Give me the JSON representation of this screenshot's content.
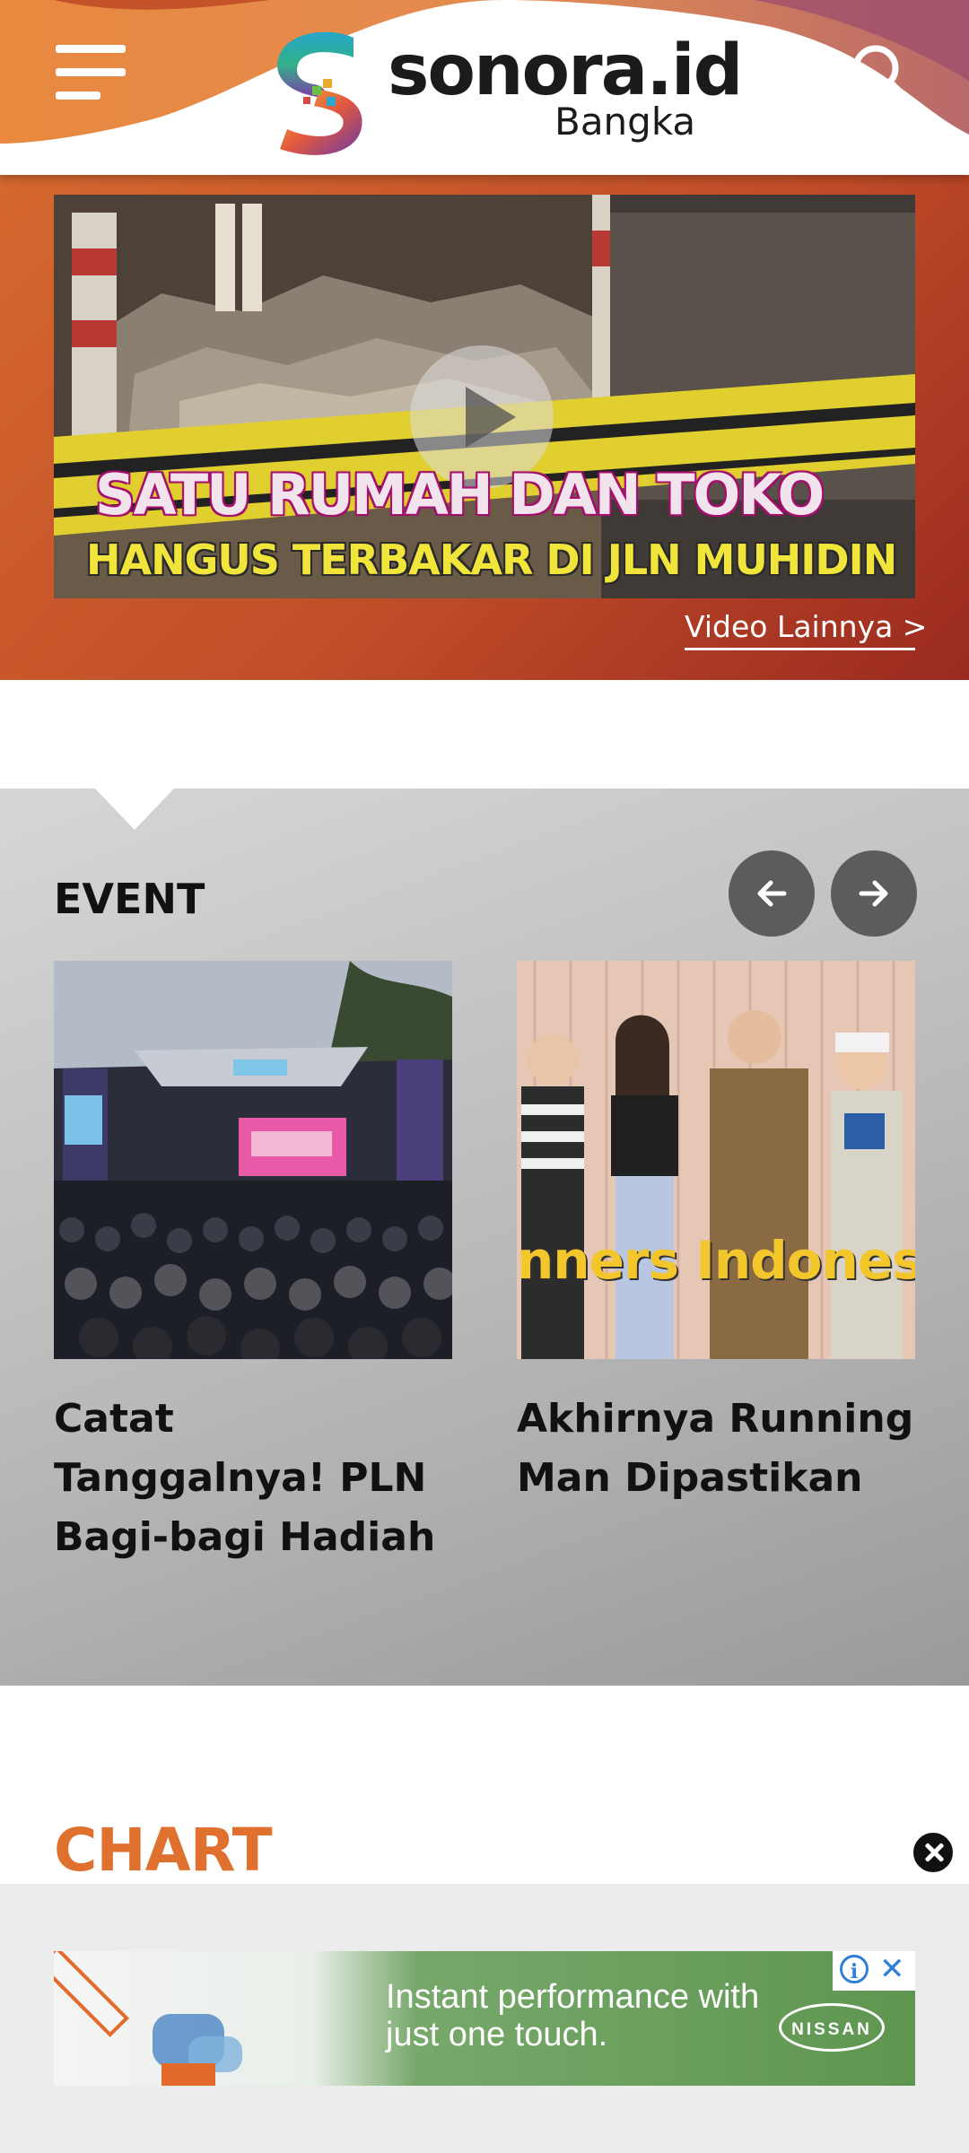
{
  "header": {
    "brand": "sonora.id",
    "region": "Bangka",
    "menu_icon": "hamburger-menu-icon",
    "search_icon": "search-icon"
  },
  "video": {
    "headline_line1": "SATU RUMAH DAN TOKO",
    "headline_line2": "HANGUS TERBAKAR DI JLN MUHIDIN",
    "play_icon": "play-icon",
    "more_link": "Video Lainnya >"
  },
  "event": {
    "title": "EVENT",
    "prev_icon": "arrow-left-icon",
    "next_icon": "arrow-right-icon",
    "cards": [
      {
        "title": "Catat Tanggalnya! PLN Bagi-bagi Hadiah"
      },
      {
        "title": "Akhirnya Running Man Dipastikan",
        "image_caption": "nners Indones"
      }
    ]
  },
  "chart_section": {
    "title": "CHART"
  },
  "ad": {
    "text": "Instant performance with just one touch.",
    "brand": "NISSAN",
    "info_icon": "i",
    "close_icon": "✕"
  },
  "colors": {
    "accent_orange": "#e0702e",
    "video_bg": "#c04d28",
    "event_bg": "#b8b8b8",
    "nav_button": "#5c5c5c"
  }
}
